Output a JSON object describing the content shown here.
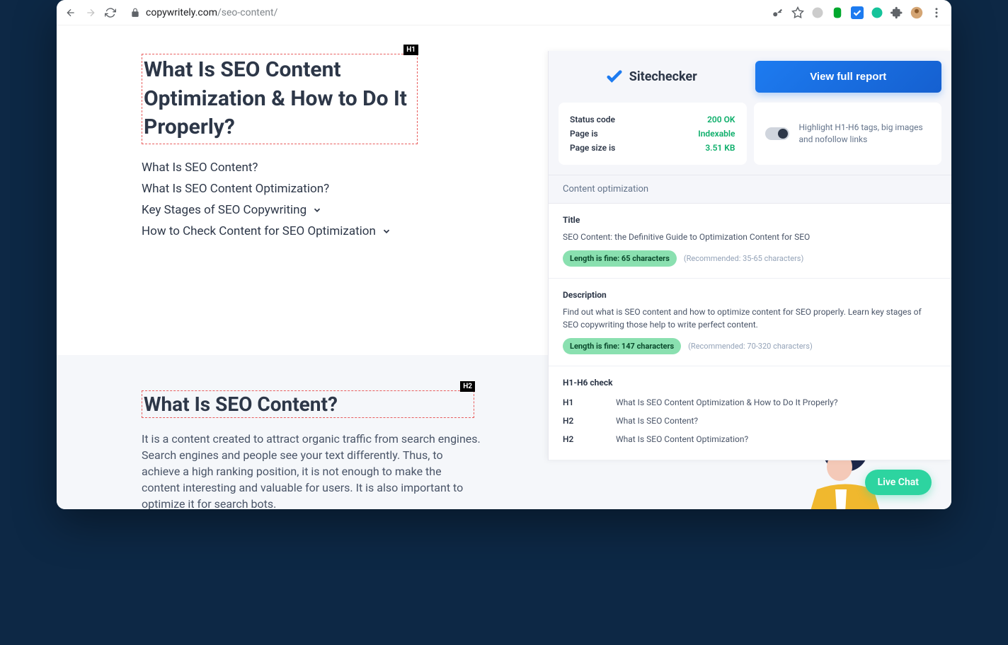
{
  "browser": {
    "url_domain": "copywritely.com",
    "url_path": "/seo-content/"
  },
  "page": {
    "h1_badge": "H1",
    "h1": "What Is SEO Content Optimization & How to Do It Properly?",
    "toc": [
      {
        "label": "What Is SEO Content?",
        "has_chevron": false
      },
      {
        "label": "What Is SEO Content Optimization?",
        "has_chevron": false
      },
      {
        "label": "Key Stages of SEO Copywriting",
        "has_chevron": true
      },
      {
        "label": "How to Check Content for SEO Optimization",
        "has_chevron": true
      }
    ],
    "h2_badge": "H2",
    "h2": "What Is SEO Content?",
    "body": "It is a content created to attract organic traffic from search engines. Search engines and people see your text differently. Thus, to achieve a high ranking position, it is not enough to make the content interesting and valuable for users. It is also important to optimize it for search bots."
  },
  "extension": {
    "brand": "Sitechecker",
    "view_report": "View full report",
    "status": [
      {
        "label": "Status code",
        "value": "200 OK"
      },
      {
        "label": "Page is",
        "value": "Indexable"
      },
      {
        "label": "Page size is",
        "value": "3.51 KB"
      }
    ],
    "toggle_label": "Highlight H1-H6 tags, big images and nofollow links",
    "section_title": "Content optimization",
    "title_check": {
      "label": "Title",
      "value": "SEO Content: the Definitive Guide to Optimization Content for SEO",
      "badge": "Length is fine: 65 characters",
      "rec": "(Recommended: 35-65 characters)"
    },
    "desc_check": {
      "label": "Description",
      "value": "Find out what is SEO content and how to optimize content for SEO properly. Learn key stages of SEO copywriting those help to write perfect content.",
      "badge": "Length is fine: 147 characters",
      "rec": "(Recommended: 70-320 characters)"
    },
    "headings_label": "H1-H6 check",
    "headings": [
      {
        "tag": "H1",
        "text": "What Is SEO Content Optimization & How to Do It Properly?"
      },
      {
        "tag": "H2",
        "text": "What Is SEO Content?"
      },
      {
        "tag": "H2",
        "text": "What Is SEO Content Optimization?"
      }
    ]
  },
  "live_chat": "Live Chat"
}
